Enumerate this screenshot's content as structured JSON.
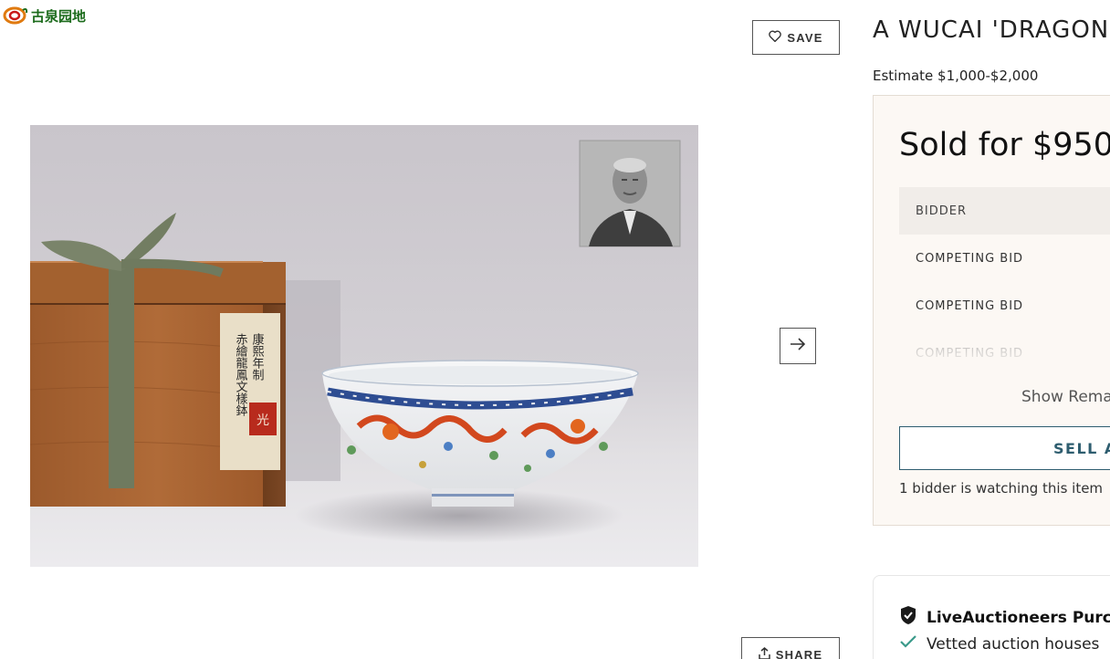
{
  "watermark": {
    "text": "古泉园地"
  },
  "toolbar": {
    "save_label": "SAVE",
    "share_label": "SHARE"
  },
  "lot": {
    "title": "A WUCAI 'DRAGON A",
    "estimate": "Estimate $1,000-$2,000"
  },
  "image": {
    "label_lines": [
      "康熙年制",
      "赤繪龍鳳文樣鉢"
    ],
    "seal_text": "光"
  },
  "bidding": {
    "sold_for": "Sold for $950",
    "table_header": "BIDDER",
    "rows": [
      {
        "label": "COMPETING BID"
      },
      {
        "label": "COMPETING BID"
      },
      {
        "label": "COMPETING BID"
      }
    ],
    "show_remaining": "Show Rema",
    "sell_button": "SELL A",
    "watchers": "1 bidder is watching this item"
  },
  "guarantee": {
    "title": "LiveAuctioneers Purch",
    "items": [
      "Vetted auction houses"
    ]
  },
  "icons": {
    "save": "heart-icon",
    "share": "share-icon",
    "next": "arrow-right-icon",
    "shield": "shield-check-icon",
    "check": "check-icon"
  },
  "colors": {
    "panel_bg": "#fcf8f4",
    "accent": "#2e5d6f",
    "check": "#3a9a8a",
    "logo_green": "#1c6b1c",
    "logo_orange": "#e07a10"
  }
}
